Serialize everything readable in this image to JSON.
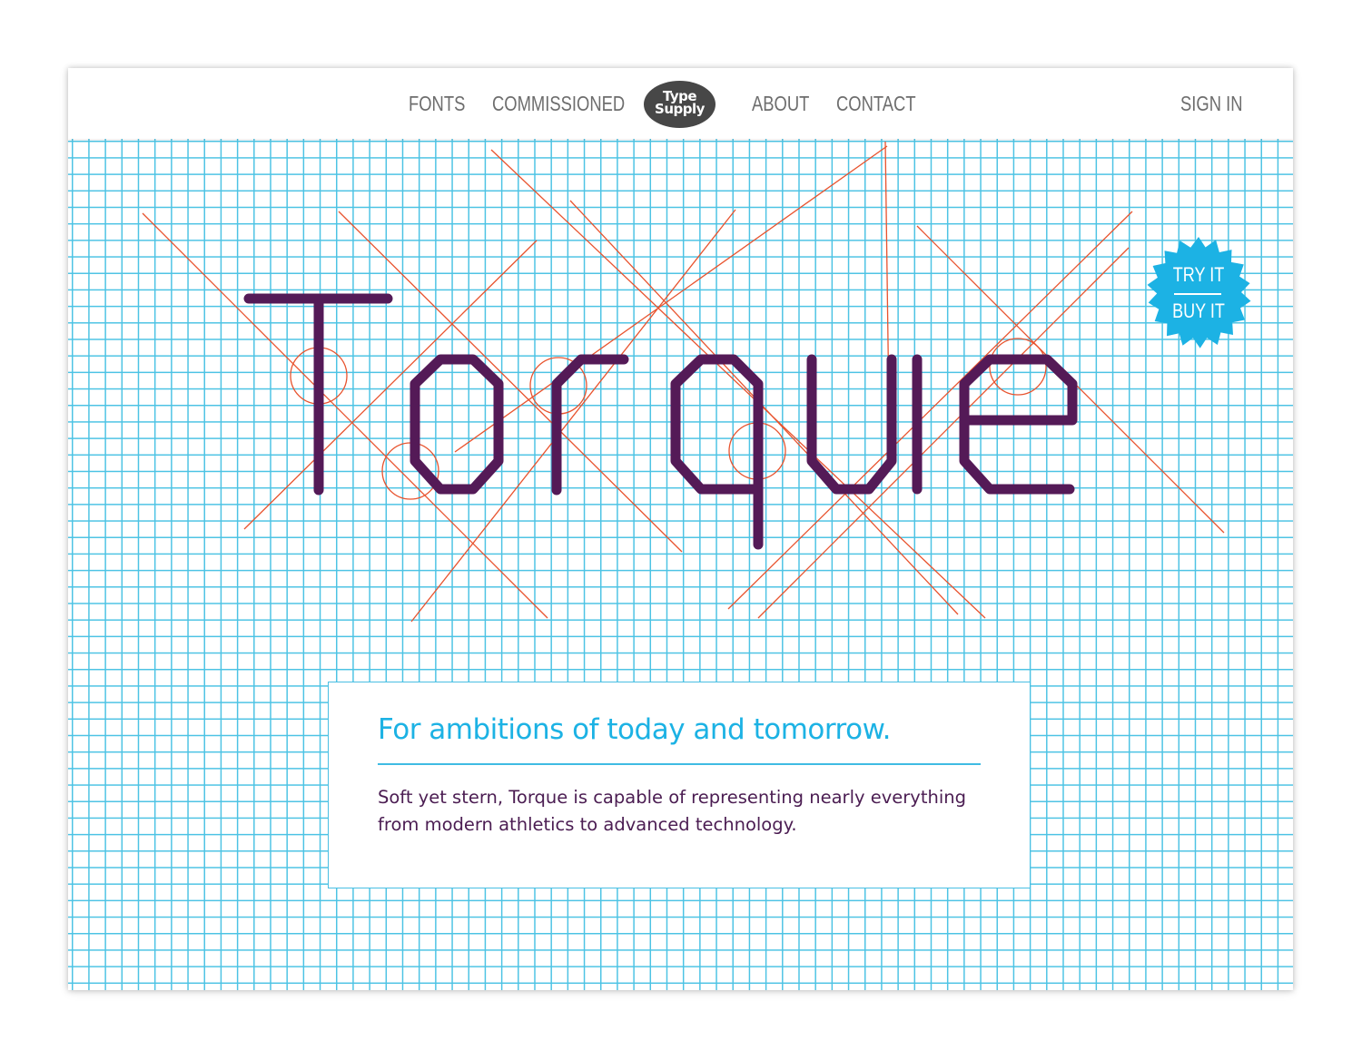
{
  "nav": {
    "links": [
      "FONTS",
      "COMMISSIONED",
      "ABOUT",
      "CONTACT"
    ],
    "logo": {
      "line1": "Type",
      "line2": "Supply"
    },
    "sign_in": "SIGN IN"
  },
  "hero": {
    "wordmark": "Torque",
    "badge": {
      "try_label": "TRY IT",
      "buy_label": "BUY IT"
    }
  },
  "card": {
    "heading": "For ambitions of today and tomorrow.",
    "body": "Soft yet stern, Torque is capable of representing nearly everything from modern athletics to advanced technology."
  },
  "colors": {
    "grid": "#4cc3e4",
    "guides": "#e8532e",
    "glyphs": "#541a57",
    "accent": "#1cb2e4",
    "nav_text": "#6d6d6d",
    "logo_bg": "#474747"
  }
}
